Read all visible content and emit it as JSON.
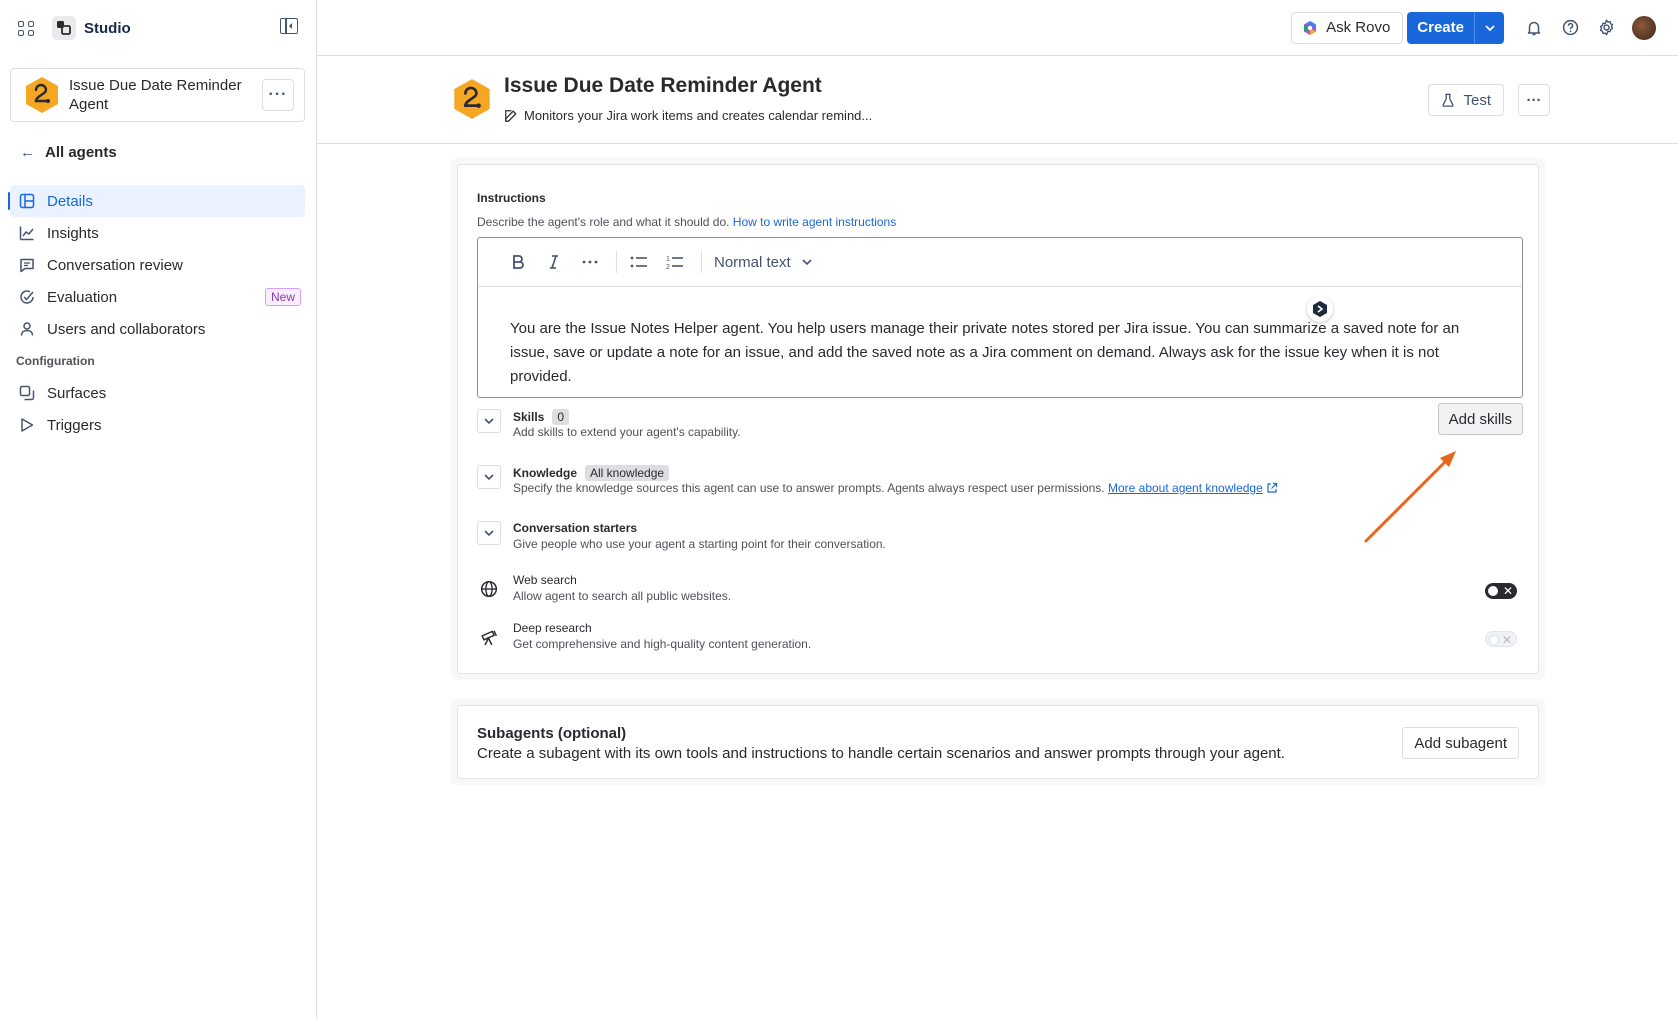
{
  "sidebar": {
    "app_title": "Studio",
    "agent_name": "Issue Due Date Reminder Agent",
    "back_label": "All agents",
    "items": [
      {
        "label": "Details",
        "icon": "details-icon",
        "active": true
      },
      {
        "label": "Insights",
        "icon": "chart-line-icon"
      },
      {
        "label": "Conversation review",
        "icon": "comment-icon"
      },
      {
        "label": "Evaluation",
        "icon": "check-circle-icon",
        "badge": "New"
      },
      {
        "label": "Users and collaborators",
        "icon": "person-icon"
      }
    ],
    "section_label": "Configuration",
    "config_items": [
      {
        "label": "Surfaces",
        "icon": "surfaces-icon"
      },
      {
        "label": "Triggers",
        "icon": "play-icon"
      }
    ]
  },
  "topbar": {
    "ask_rovo_label": "Ask Rovo",
    "create_label": "Create",
    "icons": [
      "bell-icon",
      "help-icon",
      "settings-icon",
      "avatar"
    ]
  },
  "header": {
    "title": "Issue Due Date Reminder Agent",
    "description": "Monitors your Jira work items and creates calendar remind...",
    "test_label": "Test"
  },
  "instructions": {
    "label": "Instructions",
    "help_text": "Describe the agent's role and what it should do.",
    "help_link": "How to write agent instructions",
    "text_style": "Normal text",
    "body": "You are the Issue Notes Helper agent. You help users manage their private notes stored per Jira issue. You can summarize a saved note for an issue, save or update a note for an issue, and add the saved note as a Jira comment on demand. Always ask for the issue key when it is not provided."
  },
  "skills": {
    "title": "Skills",
    "count": "0",
    "subtitle": "Add skills to extend your agent's capability.",
    "button": "Add skills"
  },
  "knowledge": {
    "title": "Knowledge",
    "badge": "All knowledge",
    "subtitle": "Specify the knowledge sources this agent can use to answer prompts. Agents always respect user permissions.",
    "link": "More about agent knowledge"
  },
  "starters": {
    "title": "Conversation starters",
    "subtitle": "Give people who use your agent a starting point for their conversation."
  },
  "web_search": {
    "title": "Web search",
    "subtitle": "Allow agent to search all public websites.",
    "enabled": false
  },
  "deep_research": {
    "title": "Deep research",
    "subtitle": "Get comprehensive and high-quality content generation.",
    "enabled": false,
    "disabled": true
  },
  "subagents": {
    "title": "Subagents (optional)",
    "description": "Create a subagent with its own tools and instructions to handle certain scenarios and answer prompts through your agent.",
    "button": "Add subagent"
  },
  "colors": {
    "accent": "#1868db",
    "annotation_arrow": "#e8651e",
    "agent_logo": "#f5a623"
  }
}
